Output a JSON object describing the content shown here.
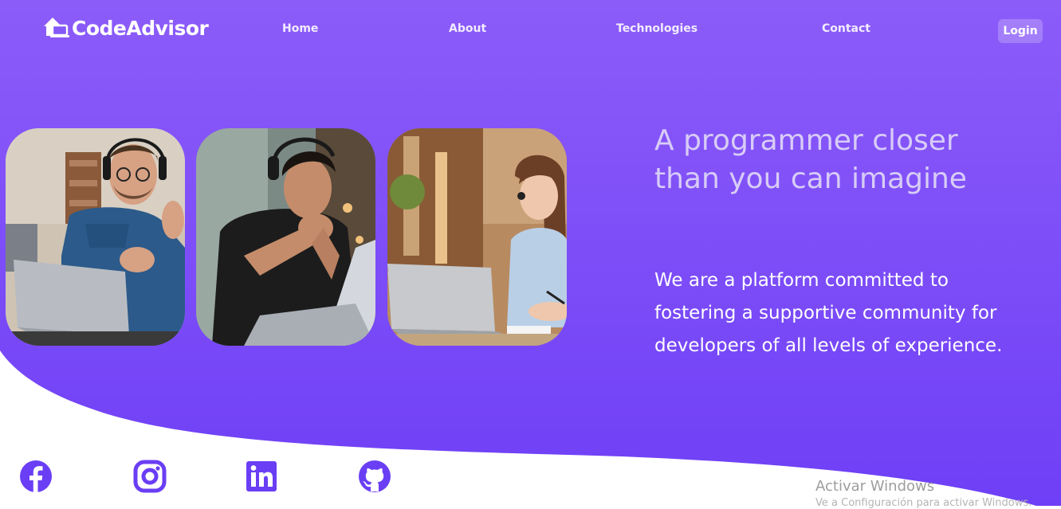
{
  "brand": {
    "name": "CodeAdvisor",
    "logo_icon": "house-laptop-icon"
  },
  "nav": {
    "items": [
      {
        "label": "Home"
      },
      {
        "label": "About"
      },
      {
        "label": "Technologies"
      },
      {
        "label": "Contact"
      }
    ],
    "login_label": "Login"
  },
  "hero": {
    "headline": "A programmer closer than you can imagine",
    "description": "We are a platform committed to fostering a supportive community for developers of all levels of experience.",
    "photos": [
      {
        "subject": "man-with-headphones-gesturing-at-laptop"
      },
      {
        "subject": "man-with-headphones-thinking-at-laptop"
      },
      {
        "subject": "woman-with-headset-writing-at-laptop"
      }
    ]
  },
  "social": {
    "items": [
      {
        "icon": "facebook-icon"
      },
      {
        "icon": "instagram-icon"
      },
      {
        "icon": "linkedin-icon"
      },
      {
        "icon": "github-icon"
      }
    ]
  },
  "watermark": {
    "title": "Activar Windows",
    "subtitle": "Ve a Configuración para activar Windows."
  },
  "colors": {
    "hero_top": "#8c5cf9",
    "hero_bottom": "#7244f7",
    "accent": "#6a3ef5",
    "headline": "#d8ccf7"
  }
}
